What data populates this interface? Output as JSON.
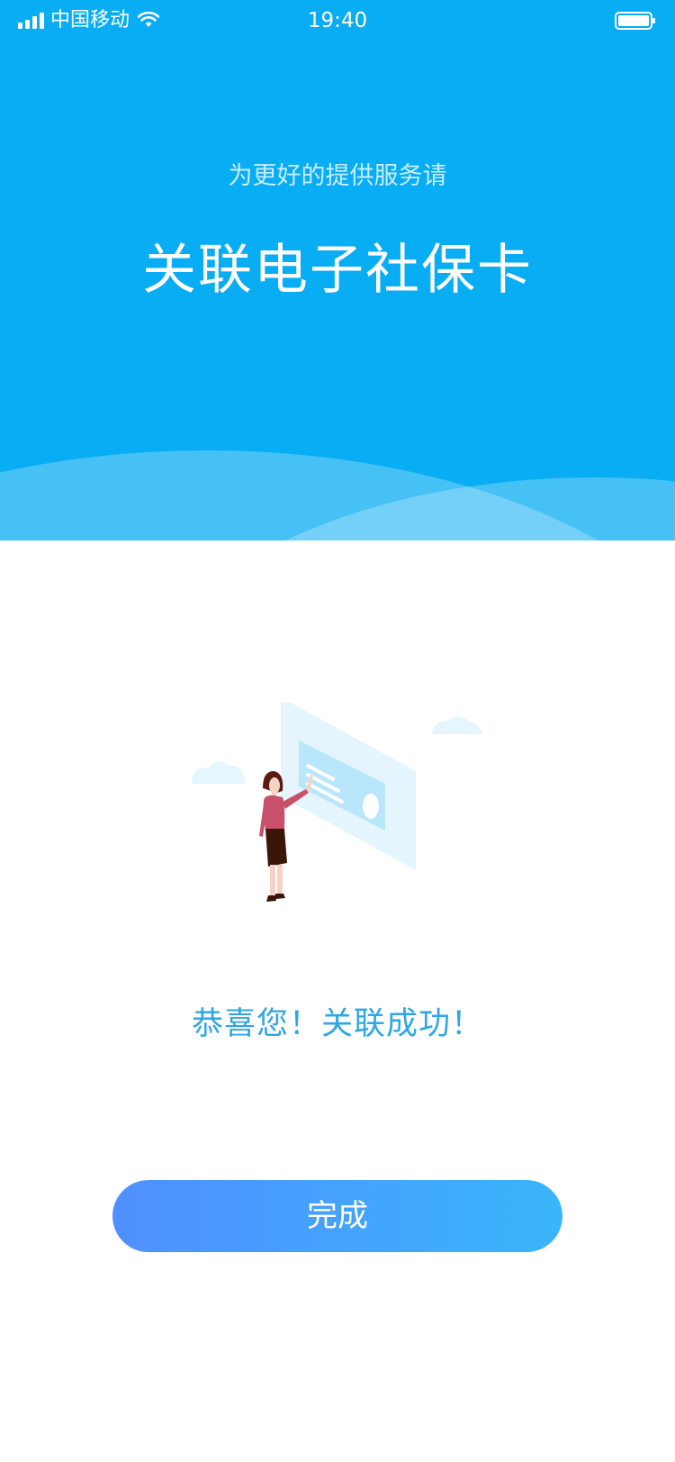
{
  "status_bar": {
    "carrier": "中国移动",
    "time": "19:40",
    "signal_icon": "cellular-signal-icon",
    "wifi_icon": "wifi-icon",
    "battery_icon": "battery-icon"
  },
  "header": {
    "subtitle": "为更好的提供服务请",
    "title": "关联电子社保卡",
    "background_color": "#08adf3"
  },
  "main": {
    "illustration": "woman-touching-card-illustration",
    "success_message": "恭喜您！关联成功！",
    "done_button_label": "完成",
    "accent_color": "#2fa6e4",
    "button_gradient": [
      "#4f8fff",
      "#3ab5fb"
    ]
  }
}
